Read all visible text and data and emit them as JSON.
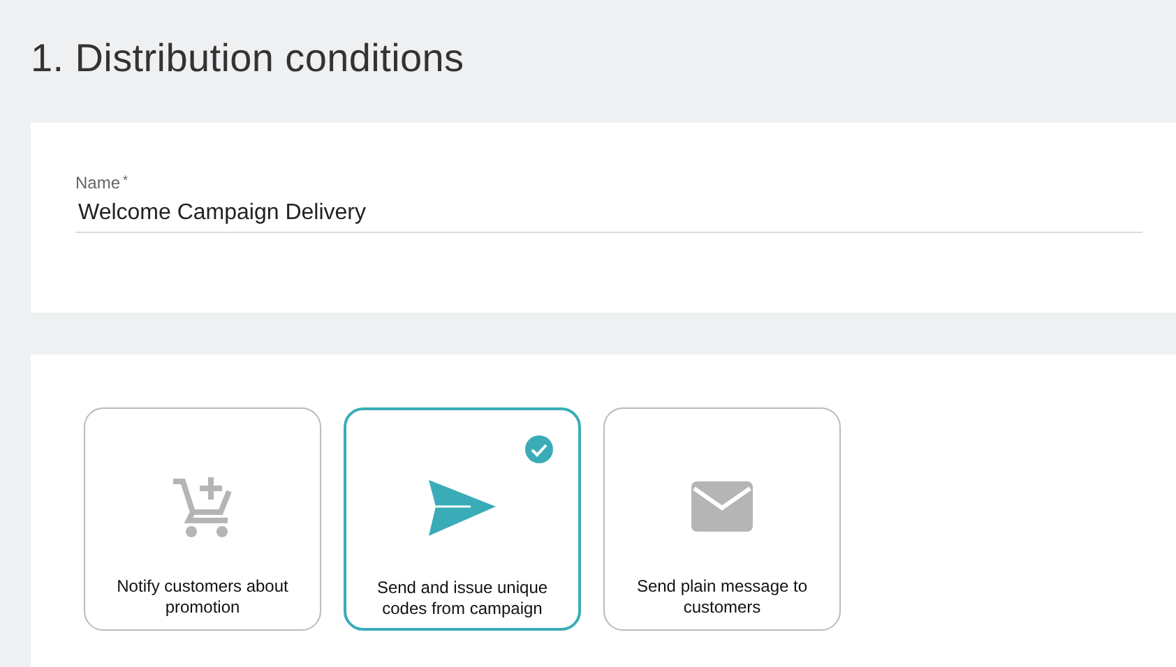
{
  "heading": "1. Distribution conditions",
  "name_field": {
    "label": "Name",
    "required_marker": "*",
    "value": "Welcome Campaign Delivery"
  },
  "options": [
    {
      "kind": "cart",
      "label": "Notify customers about promotion",
      "selected": false
    },
    {
      "kind": "send",
      "label": "Send and issue unique codes from campaign",
      "selected": true
    },
    {
      "kind": "mail",
      "label": "Send plain message to customers",
      "selected": false
    }
  ]
}
